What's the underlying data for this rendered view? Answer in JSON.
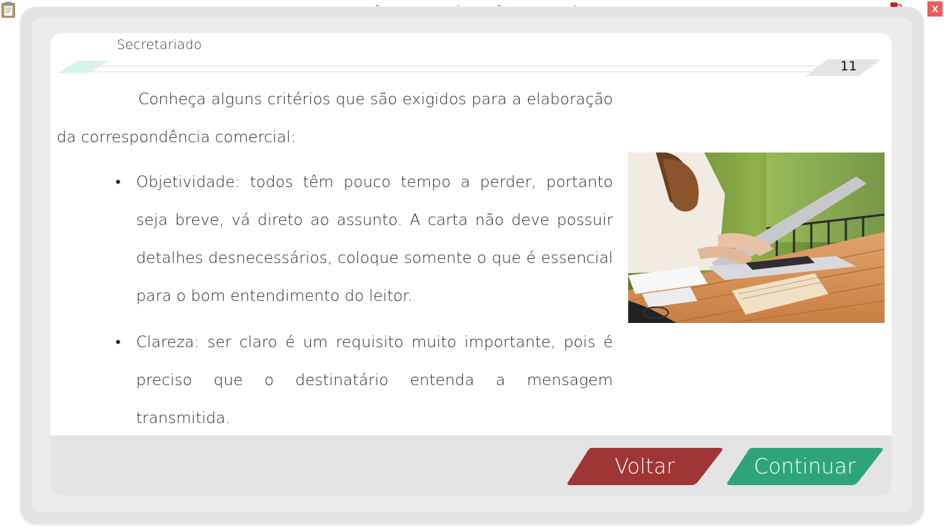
{
  "top_bar": {
    "banner": "VERSÃO PARA FUNCIONÁRIOS - NÃO COMERCIALIZÁVEL",
    "close_label": "X",
    "icons": [
      "clipboard-icon",
      "network-status-icon"
    ]
  },
  "header": {
    "section_title": "Secretariado",
    "page_number": "11"
  },
  "content": {
    "intro": "Conheça alguns critérios que são exigidos para a elaboração da correspondência comercial:",
    "bullets": [
      {
        "text": "Objetividade: todos têm pouco tempo a perder, portanto seja breve, vá direto ao assunto. A carta não deve possuir detalhes desnecessários, coloque somente o que é essencial para o bom entendimento do leitor."
      },
      {
        "text": "Clareza: ser claro é um requisito muito importante, pois é preciso que o destinatário entenda a mensagem transmitida."
      }
    ],
    "bullet_glyph": "•"
  },
  "footer": {
    "back_label": "Voltar",
    "next_label": "Continuar"
  },
  "colors": {
    "back_button": "#a03535",
    "next_button": "#2ea579",
    "accent_mint": "#d8f3ea",
    "banner_text": "#e8504f"
  }
}
